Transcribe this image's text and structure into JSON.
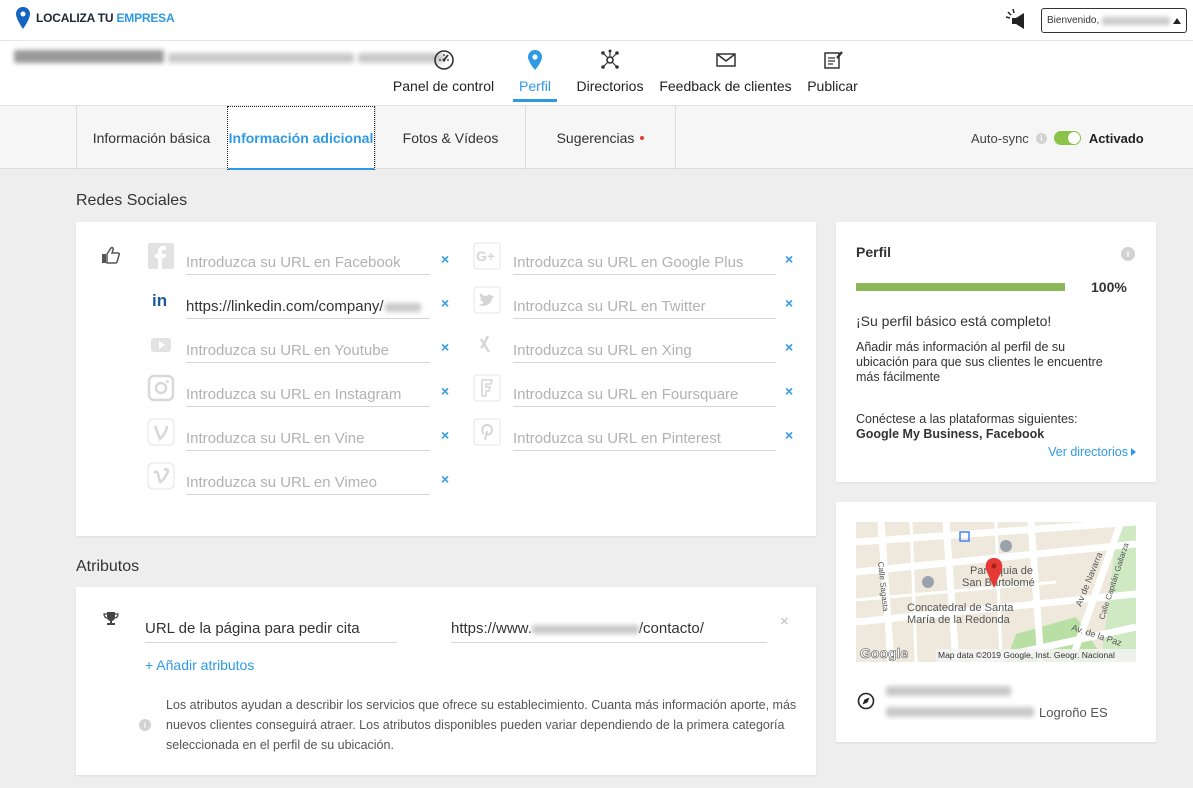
{
  "brand": {
    "name_part1": "LOCALIZA TU ",
    "name_part2": "EMPRESA"
  },
  "welcome": {
    "label": "Bienvenido,"
  },
  "nav": [
    {
      "label": "Panel de control",
      "icon": "gauge-icon"
    },
    {
      "label": "Perfil",
      "icon": "location-pin-icon",
      "active": true
    },
    {
      "label": "Directorios",
      "icon": "network-hub-icon"
    },
    {
      "label": "Feedback de clientes",
      "icon": "envelope-icon"
    },
    {
      "label": "Publicar",
      "icon": "edit-note-icon"
    }
  ],
  "tabs": [
    {
      "label": "Información básica"
    },
    {
      "label": "Información adicional",
      "active": true
    },
    {
      "label": "Fotos & Vídeos"
    },
    {
      "label": "Sugerencias",
      "badge": "red-dot"
    }
  ],
  "autosync": {
    "label": "Auto-sync",
    "state": "Activado",
    "on": true
  },
  "social": {
    "title": "Redes Sociales",
    "left": [
      {
        "network": "facebook",
        "placeholder": "Introduzca su URL en Facebook",
        "value": ""
      },
      {
        "network": "linkedin",
        "placeholder": "",
        "value": "https://linkedin.com/company/"
      },
      {
        "network": "youtube",
        "placeholder": "Introduzca su URL en Youtube",
        "value": ""
      },
      {
        "network": "instagram",
        "placeholder": "Introduzca su URL en Instagram",
        "value": ""
      },
      {
        "network": "vine",
        "placeholder": "Introduzca su URL en Vine",
        "value": ""
      },
      {
        "network": "vimeo",
        "placeholder": "Introduzca su URL en Vimeo",
        "value": ""
      }
    ],
    "right": [
      {
        "network": "google-plus",
        "placeholder": "Introduzca su URL en Google Plus",
        "value": ""
      },
      {
        "network": "twitter",
        "placeholder": "Introduzca su URL en Twitter",
        "value": ""
      },
      {
        "network": "xing",
        "placeholder": "Introduzca su URL en Xing",
        "value": ""
      },
      {
        "network": "foursquare",
        "placeholder": "Introduzca su URL en Foursquare",
        "value": ""
      },
      {
        "network": "pinterest",
        "placeholder": "Introduzca su URL en Pinterest",
        "value": ""
      }
    ],
    "remove_symbol": "×"
  },
  "attributes": {
    "title": "Atributos",
    "name": "URL de la página para pedir cita",
    "value_prefix": "https://www.",
    "value_suffix": "/contacto/",
    "remove_symbol": "×",
    "add_label": "+ Añadir atributos",
    "help": "Los atributos ayudan a describir los servicios que ofrece su establecimiento. Cuanta más información aporte, más nuevos clientes conseguirá atraer. Los atributos disponibles pueden variar dependiendo de la primera categoría seleccionada en el perfil de su ubicación."
  },
  "profile": {
    "title": "Perfil",
    "progress_pct": 100,
    "progress_label": "100%",
    "complete": "¡Su perfil básico está completo!",
    "more": "Añadir más información al perfil de su ubicación para que sus clientes le encuentre más fácilmente",
    "connect": "Conéctese a las plataformas siguientes:",
    "platforms": "Google My Business, Facebook",
    "directories_link": "Ver directorios"
  },
  "map": {
    "labels": {
      "parroquia": "Parroquia de San Bartolomé",
      "concatedral": "Concatedral de Santa María de la Redonda",
      "navarra": "Av de Navarra",
      "sagasta": "Calle Sagasta",
      "capitan": "Calle Capitán Gallarza",
      "av_paz": "Av. de la Paz"
    },
    "google_logo": "Google",
    "attribution": "Map data ©2019 Google, Inst. Geogr. Nacional",
    "city": "Logroño ES"
  },
  "colors": {
    "accent": "#2e9ae6",
    "progress": "#8bb858",
    "toggle": "#8bc34a",
    "marker": "#e53935"
  }
}
